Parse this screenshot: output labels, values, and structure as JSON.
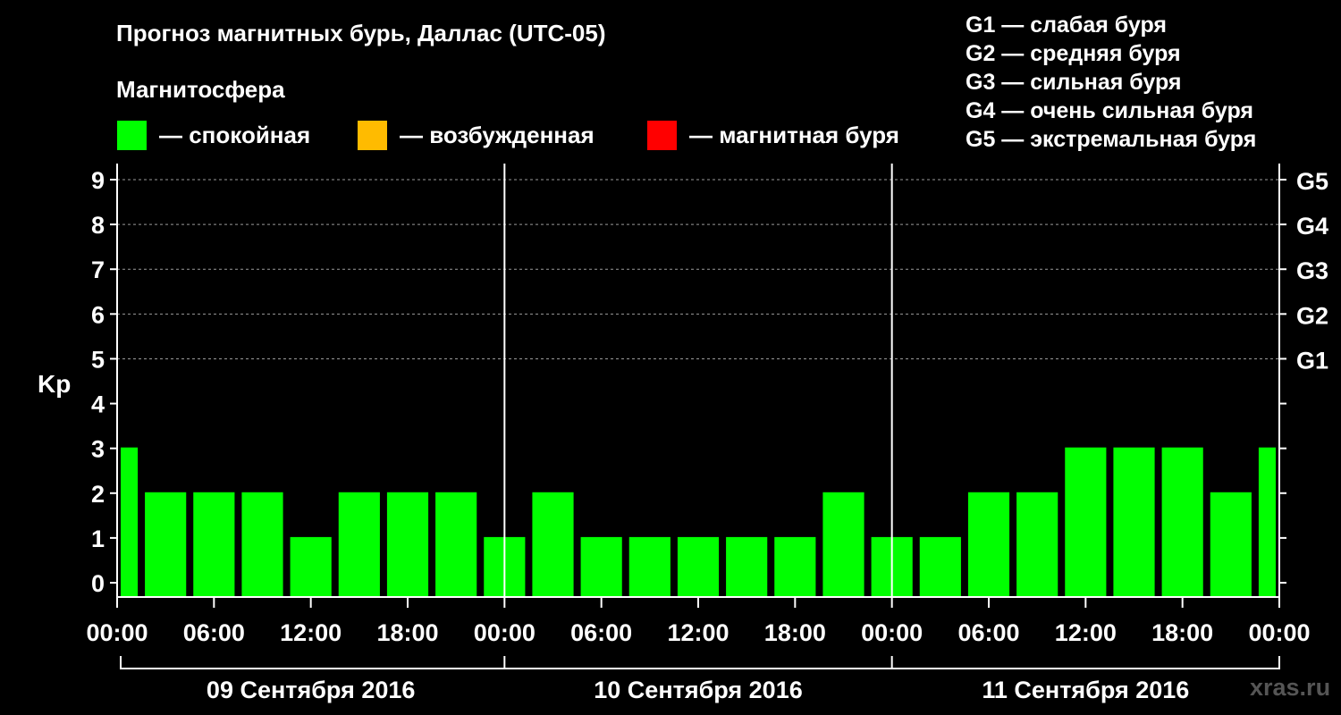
{
  "title": "Прогноз магнитных бурь, Даллас (UTC-05)",
  "subtitle": "Магнитосфера",
  "legend": [
    {
      "color": "#00ff00",
      "label": "— спокойная"
    },
    {
      "color": "#ffbb00",
      "label": "— возбужденная"
    },
    {
      "color": "#ff0000",
      "label": "— магнитная буря"
    }
  ],
  "g_scale": [
    "G1 — слабая буря",
    "G2 — средняя буря",
    "G3 — сильная буря",
    "G4 — очень сильная буря",
    "G5 — экстремальная буря"
  ],
  "source": "xras.ru",
  "chart_data": {
    "type": "bar",
    "ylabel": "Kp",
    "ylim": [
      0,
      9
    ],
    "yticks": [
      0,
      1,
      2,
      3,
      4,
      5,
      6,
      7,
      8,
      9
    ],
    "right_ticks": [
      {
        "value": 5,
        "label": "G1"
      },
      {
        "value": 6,
        "label": "G2"
      },
      {
        "value": 7,
        "label": "G3"
      },
      {
        "value": 8,
        "label": "G4"
      },
      {
        "value": 9,
        "label": "G5"
      }
    ],
    "x_tick_labels": [
      "00:00",
      "06:00",
      "12:00",
      "18:00",
      "00:00",
      "06:00",
      "12:00",
      "18:00",
      "00:00",
      "06:00",
      "12:00",
      "18:00",
      "00:00"
    ],
    "days": [
      "09 Сентября 2016",
      "10 Сентября 2016",
      "11 Сентября 2016"
    ],
    "grid": "dashed horizontal at Kp 5-9",
    "series": [
      {
        "color": "#00ff00",
        "x_hours": [
          0,
          3,
          6,
          9,
          12,
          15,
          18,
          21,
          24,
          27,
          30,
          33,
          36,
          39,
          42,
          45,
          48,
          51,
          54,
          57,
          60,
          63,
          66,
          69,
          72
        ],
        "values": [
          3,
          2,
          2,
          2,
          1,
          2,
          2,
          2,
          1,
          2,
          1,
          1,
          1,
          1,
          1,
          2,
          1,
          1,
          2,
          2,
          3,
          3,
          3,
          2,
          3
        ]
      }
    ]
  }
}
